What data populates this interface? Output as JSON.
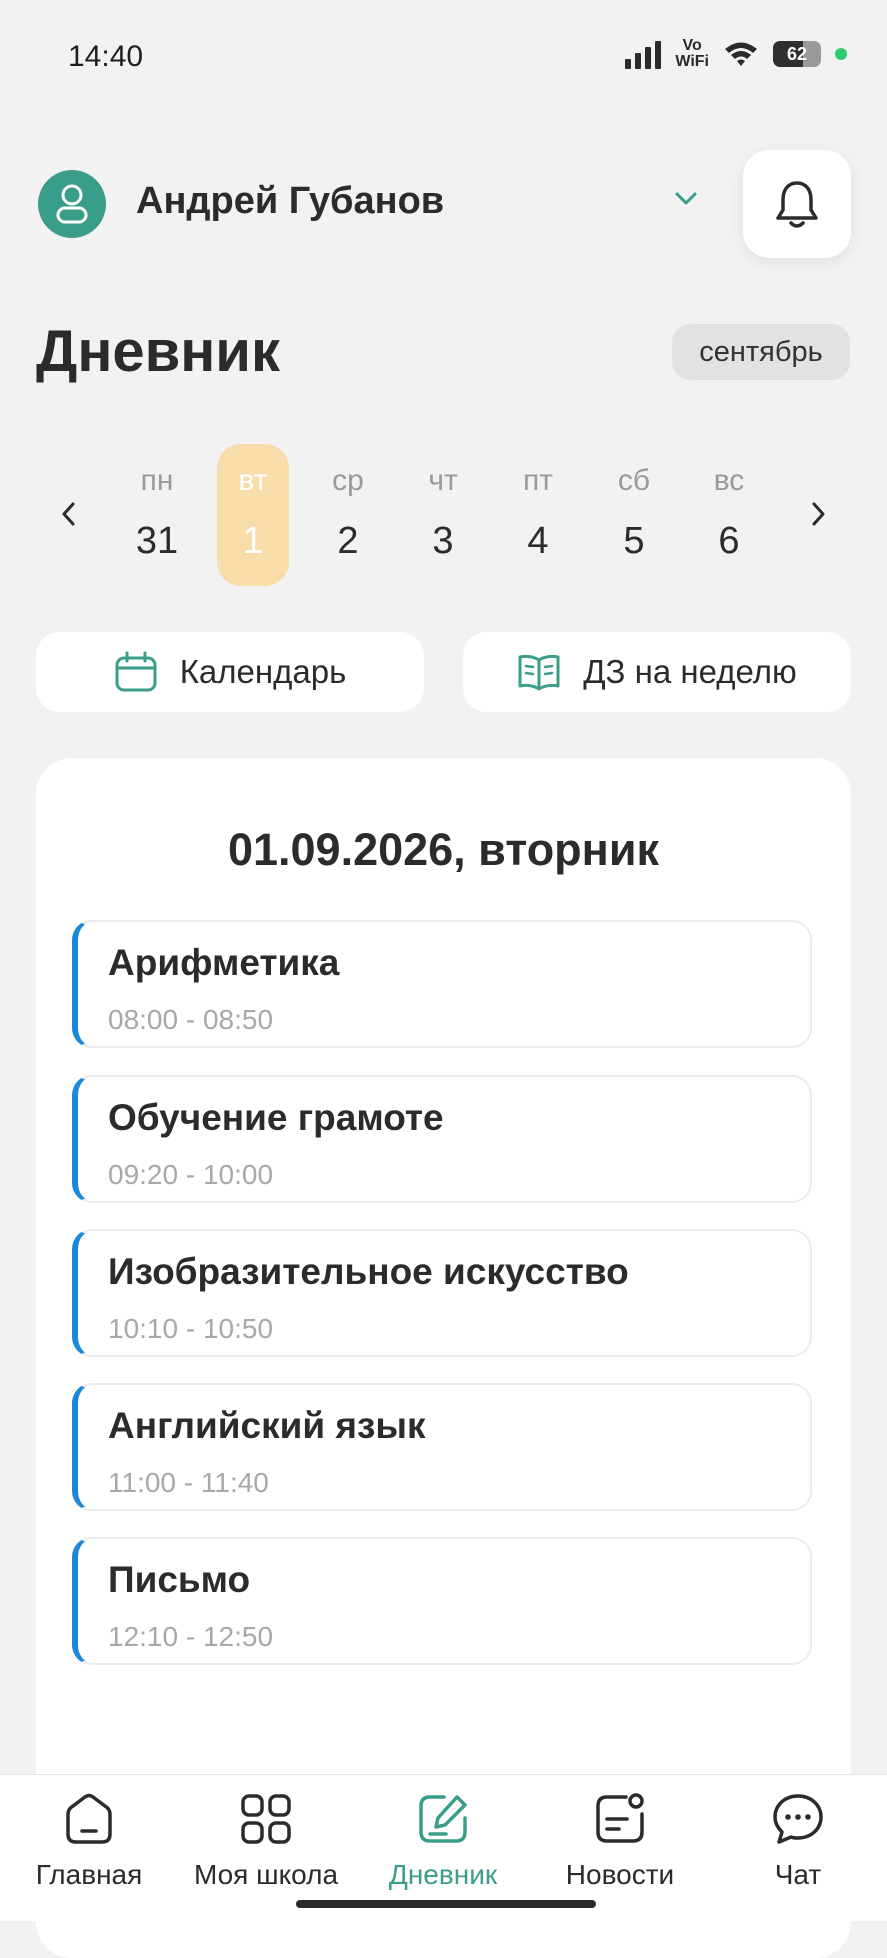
{
  "status_bar": {
    "time": "14:40",
    "vowifi_top": "Vo",
    "vowifi_bottom": "WiFi",
    "battery": "62"
  },
  "header": {
    "user_name": "Андрей Губанов"
  },
  "page": {
    "title": "Дневник",
    "month": "сентябрь"
  },
  "week": {
    "days": [
      {
        "dow": "пн",
        "num": "31"
      },
      {
        "dow": "вт",
        "num": "1",
        "selected": true
      },
      {
        "dow": "ср",
        "num": "2"
      },
      {
        "dow": "чт",
        "num": "3"
      },
      {
        "dow": "пт",
        "num": "4"
      },
      {
        "dow": "сб",
        "num": "5"
      },
      {
        "dow": "вс",
        "num": "6"
      }
    ]
  },
  "actions": {
    "calendar": "Календарь",
    "homework": "ДЗ на неделю"
  },
  "schedule": {
    "date": "01.09.2026, вторник",
    "lessons": [
      {
        "title": "Арифметика",
        "time": "08:00 - 08:50"
      },
      {
        "title": "Обучение грамоте",
        "time": "09:20 - 10:00"
      },
      {
        "title": "Изобразительное искусство",
        "time": "10:10 - 10:50"
      },
      {
        "title": "Английский язык",
        "time": "11:00 - 11:40"
      },
      {
        "title": "Письмо",
        "time": "12:10 - 12:50"
      }
    ]
  },
  "nav": {
    "items": [
      {
        "label": "Главная",
        "icon": "home-icon"
      },
      {
        "label": "Моя школа",
        "icon": "grid-icon"
      },
      {
        "label": "Дневник",
        "icon": "diary-icon",
        "active": true
      },
      {
        "label": "Новости",
        "icon": "news-icon"
      },
      {
        "label": "Чат",
        "icon": "chat-icon"
      }
    ]
  },
  "colors": {
    "accent": "#3a9d8a",
    "selected_day": "#f8ddab",
    "lesson_bar": "#1e88d8"
  }
}
